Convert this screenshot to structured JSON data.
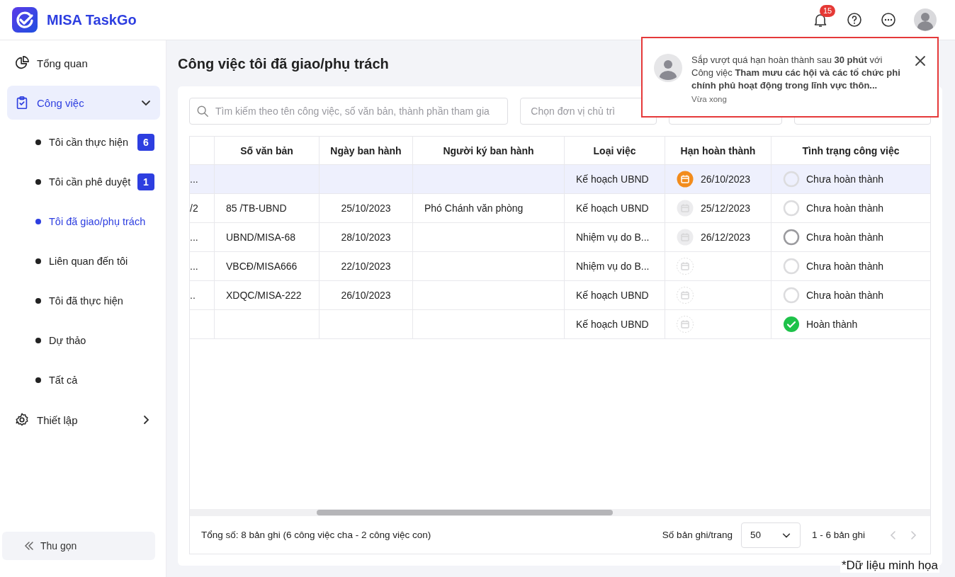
{
  "app": {
    "name": "MISA TaskGo"
  },
  "header": {
    "notification_count": "15"
  },
  "sidebar": {
    "items": [
      {
        "label": "Tổng quan",
        "kind": "chart",
        "selected": false
      },
      {
        "label": "Công việc",
        "kind": "task",
        "selected": true,
        "expanded": true,
        "children": [
          {
            "label": "Tôi cần thực hiện",
            "badge": "6",
            "selected": false
          },
          {
            "label": "Tôi cần phê duyệt",
            "badge": "1",
            "selected": false
          },
          {
            "label": "Tôi đã giao/phụ trách",
            "selected": true
          },
          {
            "label": "Liên quan đến tôi",
            "selected": false
          },
          {
            "label": "Tôi đã thực hiện",
            "selected": false
          },
          {
            "label": "Dự thảo",
            "selected": false
          },
          {
            "label": "Tất cả",
            "selected": false
          }
        ]
      },
      {
        "label": "Thiết lập",
        "kind": "gear",
        "selected": false,
        "expanded": false
      }
    ],
    "collapse": "Thu gọn"
  },
  "page": {
    "title": "Công việc tôi đã giao/phụ trách"
  },
  "filters": {
    "search": {
      "placeholder": "Tìm kiếm theo tên công việc, số văn bản, thành phần tham gia"
    },
    "unit": {
      "placeholder": "Chọn đơn vị chủ trì"
    }
  },
  "table": {
    "columns": [
      "",
      "Số văn bản",
      "Ngày ban hành",
      "Người ký ban hành",
      "Loại việc",
      "Hạn hoàn thành",
      "Tình trạng công việc"
    ],
    "rows": [
      {
        "selected": true,
        "column_1": "...",
        "type": "Kế hoạch UBND",
        "deadline": {
          "kind": "due-soon",
          "date": "26/10/2023"
        },
        "status": {
          "kind": "open",
          "label": "Chưa hoàn thành"
        }
      },
      {
        "selected": false,
        "column_1": "/2",
        "doc_no": "85 /TB-UBND",
        "issued": "25/10/2023",
        "signer": "Phó Chánh văn phòng",
        "type": "Kế hoạch UBND",
        "deadline": {
          "kind": "set",
          "date": "25/12/2023"
        },
        "status": {
          "kind": "open",
          "label": "Chưa hoàn thành"
        }
      },
      {
        "selected": false,
        "column_1": "...",
        "doc_no": "UBND/MISA-68",
        "issued": "28/10/2023",
        "type": "Nhiệm vụ do B...",
        "deadline": {
          "kind": "set",
          "date": "26/12/2023"
        },
        "status": {
          "kind": "pending",
          "label": "Chưa hoàn thành"
        }
      },
      {
        "selected": false,
        "column_1": "...",
        "doc_no": "VBCĐ/MISA666",
        "issued": "22/10/2023",
        "type": "Nhiệm vụ do B...",
        "deadline": {
          "kind": "none"
        },
        "status": {
          "kind": "open",
          "label": "Chưa hoàn thành"
        }
      },
      {
        "selected": false,
        "column_1": "..",
        "doc_no": "XDQC/MISA-222",
        "issued": "26/10/2023",
        "type": "Kế hoạch UBND",
        "deadline": {
          "kind": "none"
        },
        "status": {
          "kind": "open",
          "label": "Chưa hoàn thành"
        }
      },
      {
        "selected": false,
        "type": "Kế hoạch UBND",
        "deadline": {
          "kind": "none"
        },
        "status": {
          "kind": "done",
          "label": "Hoàn thành"
        }
      }
    ]
  },
  "footer": {
    "total": "Tổng số: 8 bản ghi (6 công việc cha - 2 công việc con)",
    "page_size_label": "Số bản ghi/trang",
    "page_size": "50",
    "range": "1 - 6 bản ghi"
  },
  "toast": {
    "message": "Sắp vượt quá hạn hoàn thành sau **30 phút** với Công việc **Tham mưu các hội và các tổ chức phi chính phủ hoạt động trong lĩnh vực thôn...**",
    "time": "Vừa xong"
  },
  "caption": "*Dữ liệu minh họa"
}
